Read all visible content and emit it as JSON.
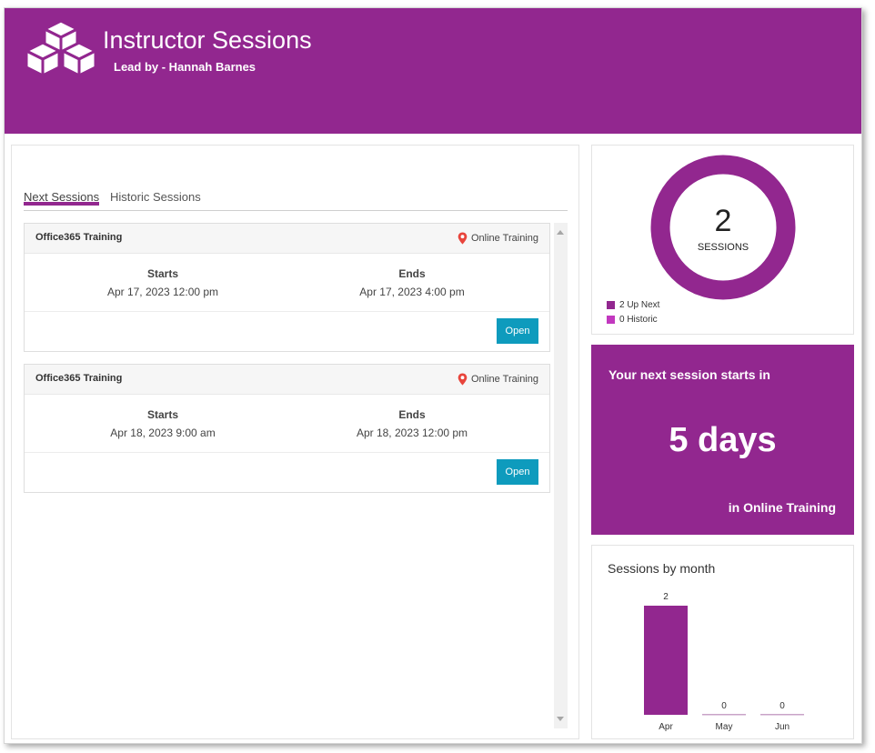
{
  "header": {
    "title": "Instructor Sessions",
    "subtitle": "Lead by - Hannah Barnes",
    "logo_icon": "boxes-icon",
    "bg_color": "#92278f"
  },
  "tabs": [
    {
      "label": "Next Sessions",
      "active": true
    },
    {
      "label": "Historic Sessions",
      "active": false
    }
  ],
  "sessions": [
    {
      "title": "Office365 Training",
      "location": "Online Training",
      "starts_label": "Starts",
      "starts": "Apr 17, 2023 12:00 pm",
      "ends_label": "Ends",
      "ends": "Apr 17, 2023 4:00 pm",
      "button": "Open"
    },
    {
      "title": "Office365 Training",
      "location": "Online Training",
      "starts_label": "Starts",
      "starts": "Apr 18, 2023 9:00 am",
      "ends_label": "Ends",
      "ends": "Apr 18, 2023 12:00 pm",
      "button": "Open"
    }
  ],
  "summary": {
    "count": "2",
    "count_label": "SESSIONS",
    "legend": [
      {
        "label": "2 Up Next",
        "color": "#92278f"
      },
      {
        "label": "0 Historic",
        "color": "#c238bf"
      }
    ]
  },
  "next_session": {
    "label": "Your next session starts in",
    "value": "5 days",
    "location": "in Online Training"
  },
  "chart_data": {
    "type": "bar",
    "title": "Sessions by month",
    "categories": [
      "Apr",
      "May",
      "Jun"
    ],
    "values": [
      2,
      0,
      0
    ],
    "ylim": [
      0,
      2
    ],
    "bar_color": "#92278f",
    "data_labels": true,
    "grid": false
  }
}
